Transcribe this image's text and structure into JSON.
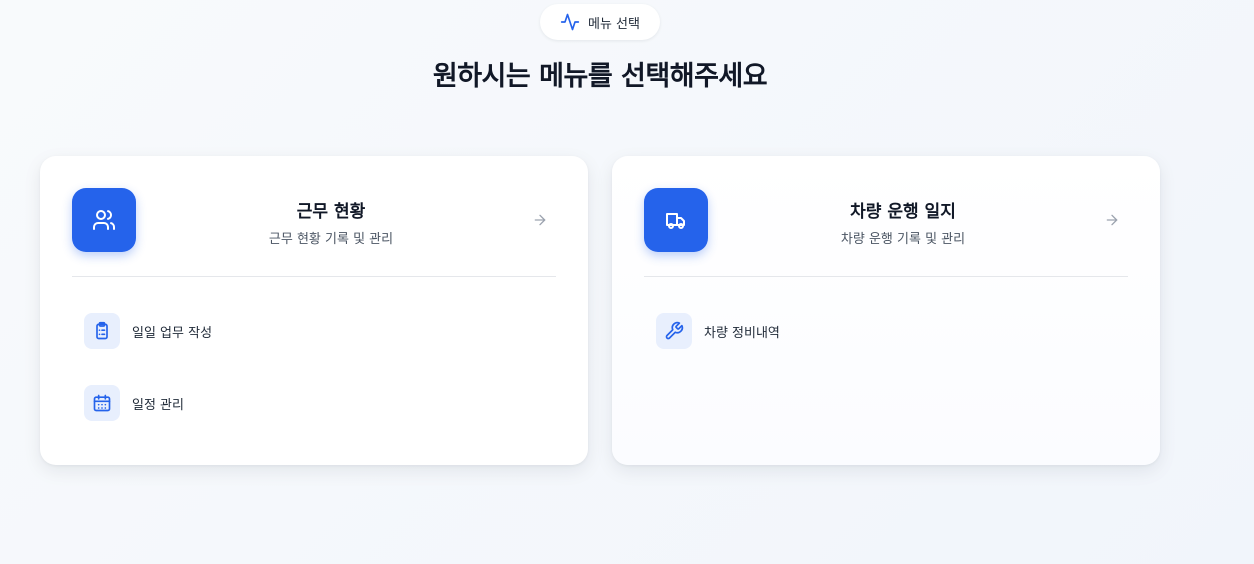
{
  "badge": {
    "icon": "activity-icon",
    "label": "메뉴 선택"
  },
  "heading": "원하시는 메뉴를 선택해주세요",
  "cards": [
    {
      "icon": "users-icon",
      "title": "근무 현황",
      "subtitle": "근무 현황 기록 및 관리",
      "items": [
        {
          "icon": "clipboard-list-icon",
          "label": "일일 업무 작성"
        },
        {
          "icon": "calendar-icon",
          "label": "일정 관리"
        }
      ]
    },
    {
      "icon": "truck-icon",
      "title": "차량 운행 일지",
      "subtitle": "차량 운행 기록 및 관리",
      "items": [
        {
          "icon": "wrench-icon",
          "label": "차량 정비내역"
        }
      ]
    }
  ],
  "colors": {
    "accent": "#2563eb",
    "icon_bg": "#e8effd",
    "text": "#111827",
    "muted": "#4b5563"
  }
}
